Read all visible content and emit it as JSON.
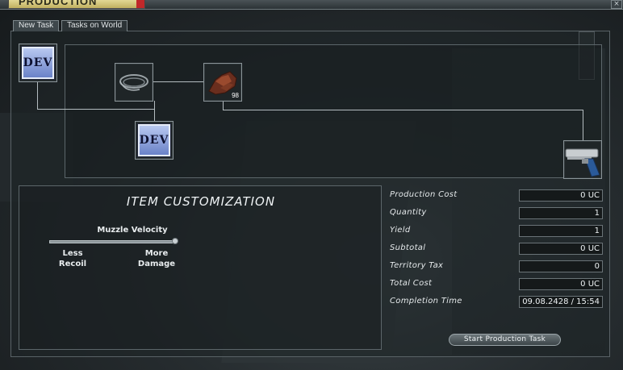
{
  "window": {
    "title": "PRODUCTION CENTER",
    "close_label": "×"
  },
  "tabs": [
    {
      "label": "New Task",
      "active": true
    },
    {
      "label": "Tasks on World",
      "active": false
    }
  ],
  "tree": {
    "nodes": [
      {
        "id": "root-dev",
        "label": "DEV",
        "icon": "dev-blueprint-icon"
      },
      {
        "id": "cable",
        "icon": "cable-coil-icon"
      },
      {
        "id": "ore",
        "icon": "ore-chunk-icon",
        "count": "98"
      },
      {
        "id": "sub-dev",
        "label": "DEV",
        "icon": "dev-blueprint-icon"
      },
      {
        "id": "output",
        "icon": "pistol-icon"
      }
    ]
  },
  "customization": {
    "title": "ITEM CUSTOMIZATION",
    "slider": {
      "label": "Muzzle Velocity",
      "min_label_1": "Less",
      "min_label_2": "Recoil",
      "max_label_1": "More",
      "max_label_2": "Damage",
      "value": 1.0
    }
  },
  "costs": [
    {
      "label": "Production Cost",
      "value": "0 UC"
    },
    {
      "label": "Quantity",
      "value": "1"
    },
    {
      "label": "Yield",
      "value": "1"
    },
    {
      "label": "Subtotal",
      "value": "0 UC"
    },
    {
      "label": "Territory Tax",
      "value": "0"
    },
    {
      "label": "Total Cost",
      "value": "0 UC"
    },
    {
      "label": "Completion Time",
      "value": "09.08.2428 / 15:54"
    }
  ],
  "start_button": "Start Production Task",
  "colors": {
    "dev_button": "#8aa0e0",
    "panel_border": "#5c666a"
  }
}
